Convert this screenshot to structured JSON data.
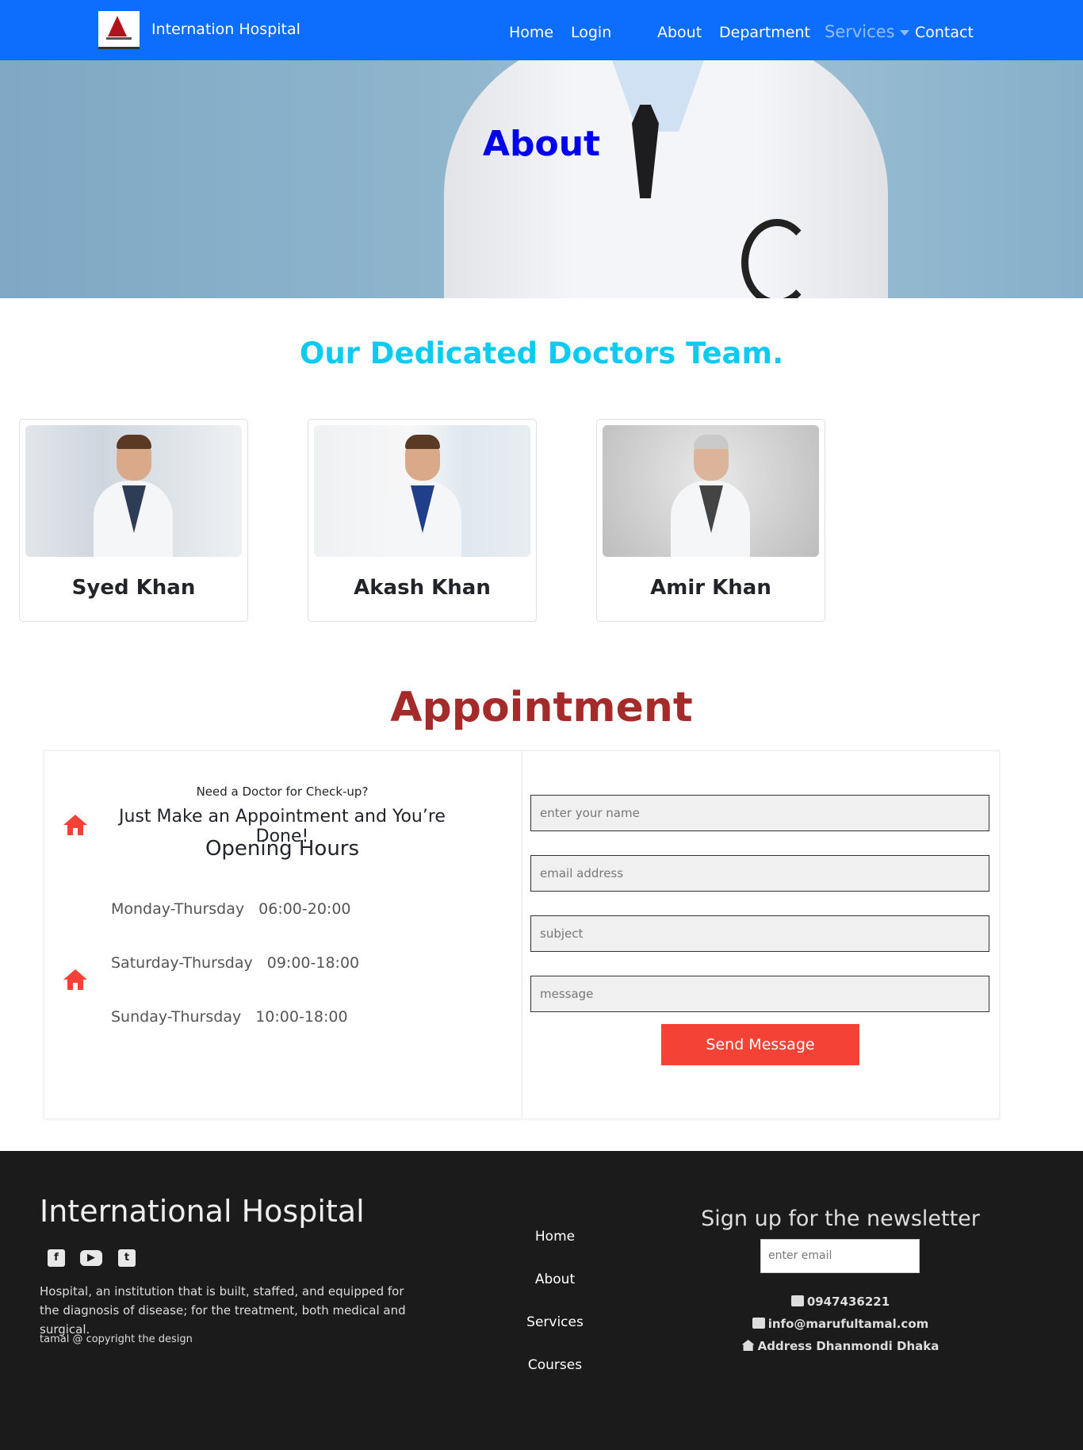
{
  "navbar": {
    "brand": "Internation Hospital",
    "links": [
      "Home",
      "Login",
      "About",
      "Department",
      "Services",
      "Contact"
    ]
  },
  "hero": {
    "title": "About"
  },
  "team": {
    "heading": "Our Dedicated Doctors Team.",
    "doctors": [
      {
        "name": "Syed Khan"
      },
      {
        "name": "Akash Khan"
      },
      {
        "name": "Amir Khan"
      }
    ]
  },
  "appointment": {
    "heading": "Appointment",
    "need_doctor": "Need a Doctor for Check-up?",
    "tagline": "Just Make an Appointment and You’re Done!",
    "opening_title": "Opening Hours",
    "hours": [
      {
        "days": "Monday-Thursday",
        "time": "06:00-20:00"
      },
      {
        "days": "Saturday-Thursday",
        "time": "09:00-18:00"
      },
      {
        "days": "Sunday-Thursday",
        "time": "10:00-18:00"
      }
    ],
    "form": {
      "name_placeholder": "enter your name",
      "email_placeholder": "email address",
      "subject_placeholder": "subject",
      "message_placeholder": "message",
      "submit_label": "Send Message"
    }
  },
  "footer": {
    "title": "International Hospital",
    "social_icons": [
      "facebook-icon",
      "youtube-icon",
      "twitter-icon"
    ],
    "description": "Hospital, an institution that is built, staffed, and equipped for the diagnosis of disease; for the treatment, both medical and surgical.",
    "copyright": "tamal @ copyright the design",
    "links": [
      "Home",
      "About",
      "Services",
      "Courses"
    ],
    "newsletter": {
      "title": "Sign up for the newsletter",
      "placeholder": "enter email"
    },
    "contact": {
      "phone": "0947436221",
      "email": "info@marufultamal.com",
      "address": "Address Dhanmondi Dhaka"
    }
  },
  "colors": {
    "navbar": "#0d6efd",
    "hero_title": "#0000ee",
    "team_heading": "#0dcaf0",
    "appointment_heading": "#a52a2a",
    "accent_red": "#f44336",
    "footer_bg": "#1b1b1c"
  }
}
